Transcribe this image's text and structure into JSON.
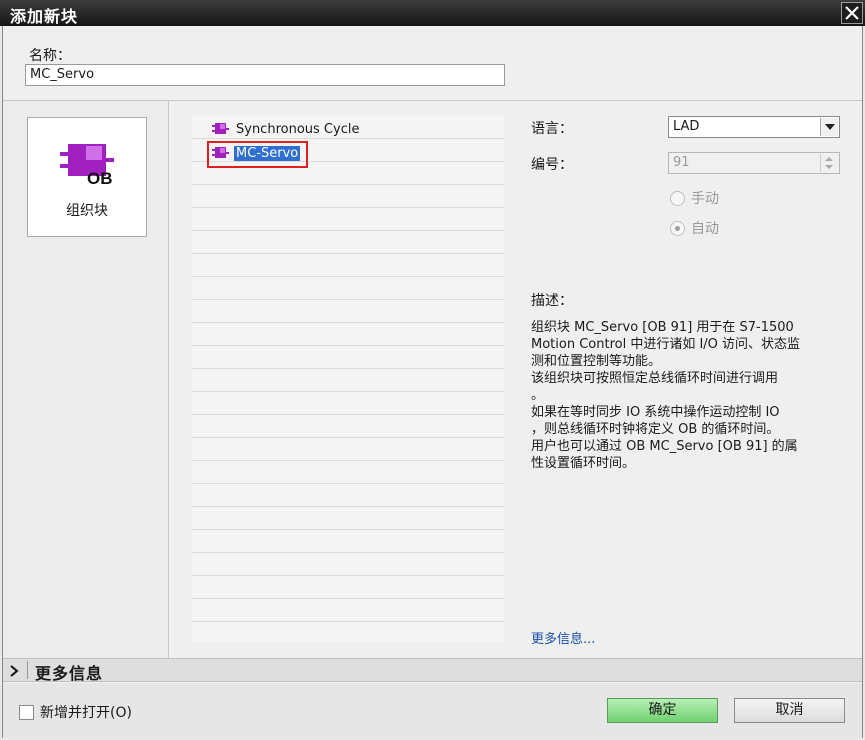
{
  "window": {
    "title": "添加新块"
  },
  "name": {
    "label": "名称：",
    "value": "MC_Servo"
  },
  "block_types": [
    {
      "label": "组织块",
      "icon": "ob-block-icon",
      "badge": "OB"
    }
  ],
  "list": {
    "items": [
      {
        "label": "Synchronous Cycle",
        "selected": false
      },
      {
        "label": "MC-Servo",
        "selected": true
      }
    ]
  },
  "props": {
    "language_label": "语言：",
    "language_value": "LAD",
    "number_label": "编号：",
    "number_value": "91",
    "manual_label": "手动",
    "auto_label": "自动",
    "selected_mode": "auto",
    "description_label": "描述：",
    "description_lines": [
      "组织块 MC_Servo [OB 91] 用于在 S7-1500",
      "Motion Control 中进行诸如 I/O 访问、状态监",
      "测和位置控制等功能。",
      "该组织块可按照恒定总线循环时间进行调用",
      "。",
      "如果在等时同步 IO 系统中操作运动控制 IO",
      "，则总线循环时钟将定义 OB 的循环时间。",
      "用户也可以通过 OB MC_Servo [OB 91] 的属",
      "性设置循环时间。"
    ],
    "more_info_link": "更多信息..."
  },
  "more_bar": {
    "label": "更多信息"
  },
  "footer": {
    "checkbox_label": "新增并打开(O)",
    "ok_label": "确定",
    "cancel_label": "取消"
  },
  "colors": {
    "selection": "#2f6fd0",
    "highlight_box": "#e02020",
    "ob_purple": "#a020c0",
    "ok_green": "#6fd06f"
  }
}
